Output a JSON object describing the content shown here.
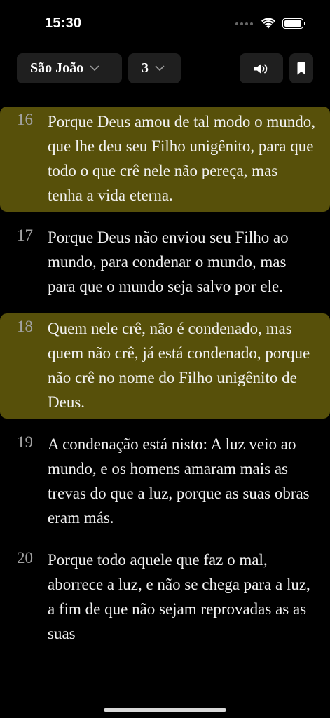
{
  "status_bar": {
    "time": "15:30"
  },
  "toolbar": {
    "book_label": "São João",
    "chapter_label": "3",
    "audio_icon": "speaker-icon",
    "bookmark_icon": "bookmark-icon"
  },
  "verses": [
    {
      "number": "16",
      "text": "Porque Deus amou de tal modo o mundo, que lhe deu seu Filho unigênito, para que todo o que crê nele não pereça, mas tenha a vida eterna.",
      "highlighted": true
    },
    {
      "number": "17",
      "text": "Porque Deus não enviou seu Filho ao mundo, para condenar o mundo, mas para que o mundo seja salvo por ele.",
      "highlighted": false
    },
    {
      "number": "18",
      "text": "Quem nele crê, não é condenado, mas quem não crê, já está condenado, porque não crê no nome do Filho unigênito de Deus.",
      "highlighted": true
    },
    {
      "number": "19",
      "text": "A condenação está nisto: A luz veio ao mundo, e os homens amaram mais as trevas do que a luz, porque as suas obras eram más.",
      "highlighted": false
    },
    {
      "number": "20",
      "text": "Porque todo aquele que faz o mal, aborrece a luz, e não se chega para a luz, a fim de que não sejam reprovadas as as suas",
      "highlighted": false
    }
  ],
  "colors": {
    "highlight": "#57500a",
    "background": "#000000",
    "pill": "#1f1f1f"
  }
}
